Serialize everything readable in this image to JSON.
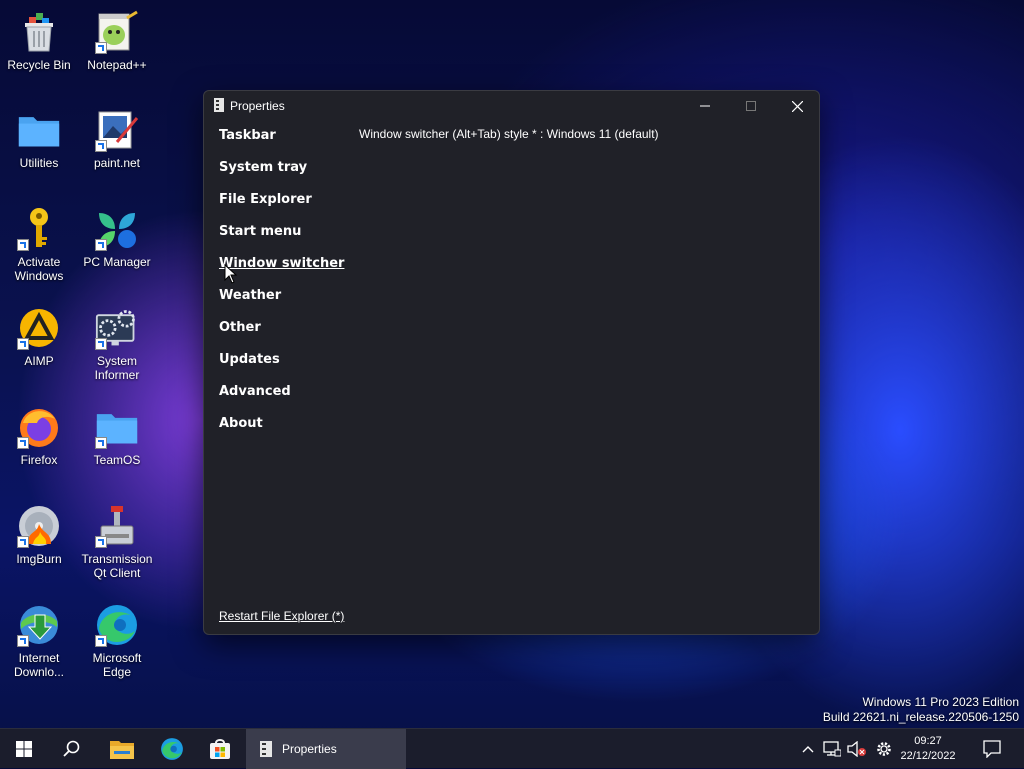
{
  "desktop": {
    "icons": [
      {
        "label": "Recycle Bin"
      },
      {
        "label": "Notepad++"
      },
      {
        "label": "Utilities"
      },
      {
        "label": "paint.net"
      },
      {
        "label": "Activate Windows"
      },
      {
        "label": "PC Manager"
      },
      {
        "label": "AIMP"
      },
      {
        "label": "System Informer"
      },
      {
        "label": "Firefox"
      },
      {
        "label": "TeamOS"
      },
      {
        "label": "ImgBurn"
      },
      {
        "label": "Transmission Qt Client"
      },
      {
        "label": "Internet Downlo..."
      },
      {
        "label": "Microsoft Edge"
      }
    ],
    "edition_line1": "Windows 11 Pro 2023 Edition",
    "edition_line2": "Build 22621.ni_release.220506-1250"
  },
  "window": {
    "title": "Properties",
    "nav": [
      {
        "label": "Taskbar"
      },
      {
        "label": "System tray"
      },
      {
        "label": "File Explorer"
      },
      {
        "label": "Start menu"
      },
      {
        "label": "Window switcher"
      },
      {
        "label": "Weather"
      },
      {
        "label": "Other"
      },
      {
        "label": "Updates"
      },
      {
        "label": "Advanced"
      },
      {
        "label": "About"
      }
    ],
    "active_nav": "Window switcher",
    "setting_line": "Window switcher (Alt+Tab) style * : Windows 11 (default)",
    "restart_link": "Restart File Explorer (*)"
  },
  "taskbar": {
    "active_app": "Properties",
    "time": "09:27",
    "date": "22/12/2022"
  },
  "colors": {
    "window_bg": "#202128",
    "taskbar_bg": "#1b1d2c",
    "accent": "#1a73e8"
  }
}
